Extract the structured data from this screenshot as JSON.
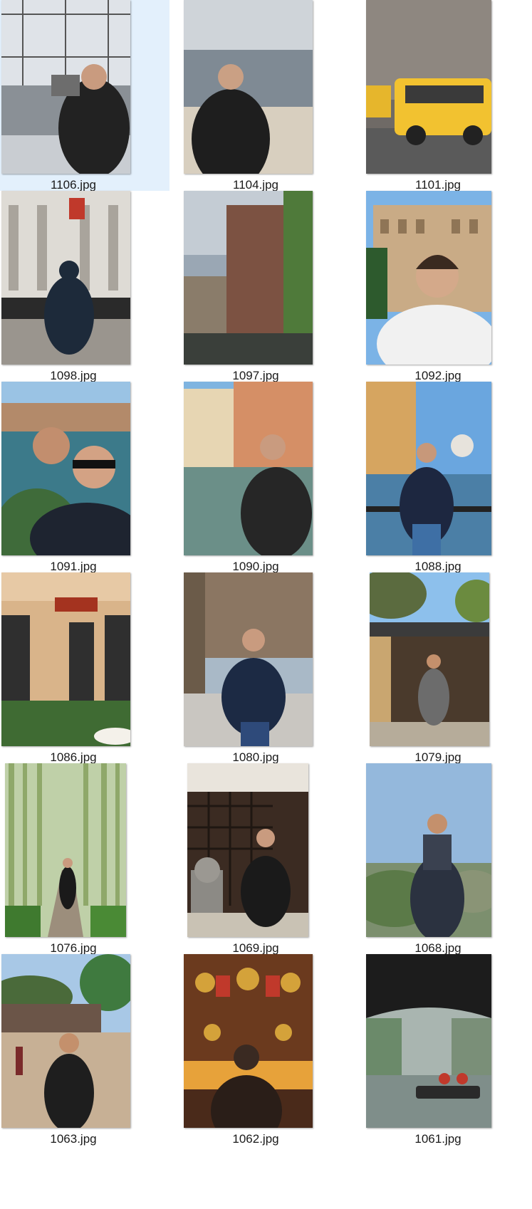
{
  "files": [
    {
      "name": "1106.jpg",
      "selected": true
    },
    {
      "name": "1104.jpg"
    },
    {
      "name": "1101.jpg"
    },
    {
      "name": "1098.jpg"
    },
    {
      "name": "1097.jpg"
    },
    {
      "name": "1092.jpg"
    },
    {
      "name": "1091.jpg"
    },
    {
      "name": "1090.jpg"
    },
    {
      "name": "1088.jpg"
    },
    {
      "name": "1086.jpg"
    },
    {
      "name": "1080.jpg"
    },
    {
      "name": "1079.jpg"
    },
    {
      "name": "1076.jpg"
    },
    {
      "name": "1069.jpg"
    },
    {
      "name": "1068.jpg"
    },
    {
      "name": "1063.jpg"
    },
    {
      "name": "1062.jpg"
    },
    {
      "name": "1061.jpg"
    }
  ],
  "colors": {
    "selection": "#e3f0fc",
    "label_text": "#1a1a1a"
  }
}
